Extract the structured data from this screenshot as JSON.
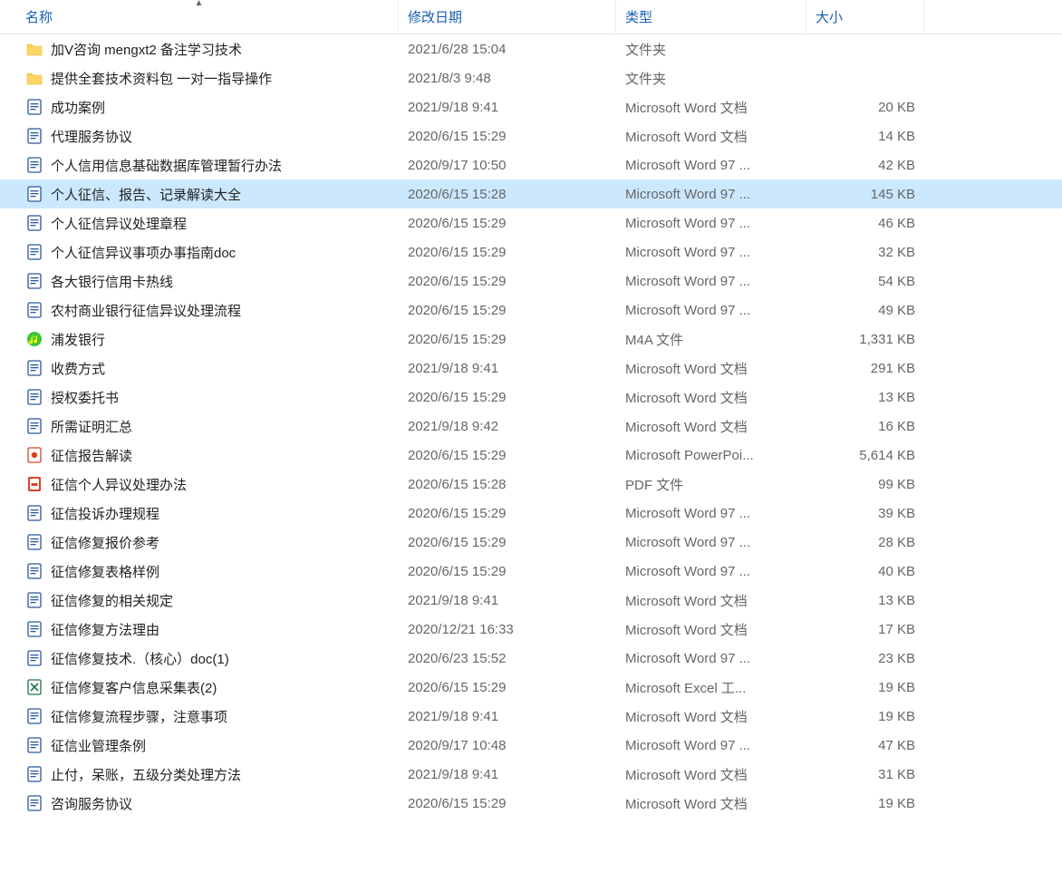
{
  "columns": {
    "name": "名称",
    "date": "修改日期",
    "type": "类型",
    "size": "大小"
  },
  "icons": {
    "folder": "folder",
    "docx": "docx",
    "doc97": "doc97",
    "xlsx": "xlsx",
    "pptx": "pptx",
    "pdf": "pdf",
    "m4a": "m4a"
  },
  "files": [
    {
      "icon": "folder",
      "name": "加V咨询   mengxt2  备注学习技术",
      "date": "2021/6/28 15:04",
      "type": "文件夹",
      "size": "",
      "selected": false
    },
    {
      "icon": "folder",
      "name": "提供全套技术资料包 一对一指导操作",
      "date": "2021/8/3 9:48",
      "type": "文件夹",
      "size": "",
      "selected": false
    },
    {
      "icon": "docx",
      "name": "成功案例",
      "date": "2021/9/18 9:41",
      "type": "Microsoft Word 文档",
      "size": "20 KB",
      "selected": false
    },
    {
      "icon": "docx",
      "name": "代理服务协议",
      "date": "2020/6/15 15:29",
      "type": "Microsoft Word 文档",
      "size": "14 KB",
      "selected": false
    },
    {
      "icon": "doc97",
      "name": "个人信用信息基础数据库管理暂行办法",
      "date": "2020/9/17 10:50",
      "type": "Microsoft Word 97 ...",
      "size": "42 KB",
      "selected": false
    },
    {
      "icon": "doc97",
      "name": "个人征信、报告、记录解读大全",
      "date": "2020/6/15 15:28",
      "type": "Microsoft Word 97 ...",
      "size": "145 KB",
      "selected": true
    },
    {
      "icon": "doc97",
      "name": "个人征信异议处理章程",
      "date": "2020/6/15 15:29",
      "type": "Microsoft Word 97 ...",
      "size": "46 KB",
      "selected": false
    },
    {
      "icon": "doc97",
      "name": "个人征信异议事项办事指南doc",
      "date": "2020/6/15 15:29",
      "type": "Microsoft Word 97 ...",
      "size": "32 KB",
      "selected": false
    },
    {
      "icon": "doc97",
      "name": "各大银行信用卡热线",
      "date": "2020/6/15 15:29",
      "type": "Microsoft Word 97 ...",
      "size": "54 KB",
      "selected": false
    },
    {
      "icon": "doc97",
      "name": "农村商业银行征信异议处理流程",
      "date": "2020/6/15 15:29",
      "type": "Microsoft Word 97 ...",
      "size": "49 KB",
      "selected": false
    },
    {
      "icon": "m4a",
      "name": "浦发银行",
      "date": "2020/6/15 15:29",
      "type": "M4A 文件",
      "size": "1,331 KB",
      "selected": false
    },
    {
      "icon": "docx",
      "name": "收费方式",
      "date": "2021/9/18 9:41",
      "type": "Microsoft Word 文档",
      "size": "291 KB",
      "selected": false
    },
    {
      "icon": "docx",
      "name": "授权委托书",
      "date": "2020/6/15 15:29",
      "type": "Microsoft Word 文档",
      "size": "13 KB",
      "selected": false
    },
    {
      "icon": "docx",
      "name": "所需证明汇总",
      "date": "2021/9/18 9:42",
      "type": "Microsoft Word 文档",
      "size": "16 KB",
      "selected": false
    },
    {
      "icon": "pptx",
      "name": "征信报告解读",
      "date": "2020/6/15 15:29",
      "type": "Microsoft PowerPoi...",
      "size": "5,614 KB",
      "selected": false
    },
    {
      "icon": "pdf",
      "name": "征信个人异议处理办法",
      "date": "2020/6/15 15:28",
      "type": "PDF 文件",
      "size": "99 KB",
      "selected": false
    },
    {
      "icon": "doc97",
      "name": "征信投诉办理规程",
      "date": "2020/6/15 15:29",
      "type": "Microsoft Word 97 ...",
      "size": "39 KB",
      "selected": false
    },
    {
      "icon": "doc97",
      "name": "征信修复报价参考",
      "date": "2020/6/15 15:29",
      "type": "Microsoft Word 97 ...",
      "size": "28 KB",
      "selected": false
    },
    {
      "icon": "doc97",
      "name": "征信修复表格样例",
      "date": "2020/6/15 15:29",
      "type": "Microsoft Word 97 ...",
      "size": "40 KB",
      "selected": false
    },
    {
      "icon": "docx",
      "name": "征信修复的相关规定",
      "date": "2021/9/18 9:41",
      "type": "Microsoft Word 文档",
      "size": "13 KB",
      "selected": false
    },
    {
      "icon": "docx",
      "name": "征信修复方法理由",
      "date": "2020/12/21 16:33",
      "type": "Microsoft Word 文档",
      "size": "17 KB",
      "selected": false
    },
    {
      "icon": "doc97",
      "name": "征信修复技术.（核心）doc(1)",
      "date": "2020/6/23 15:52",
      "type": "Microsoft Word 97 ...",
      "size": "23 KB",
      "selected": false
    },
    {
      "icon": "xlsx",
      "name": "征信修复客户信息采集表(2)",
      "date": "2020/6/15 15:29",
      "type": "Microsoft Excel 工...",
      "size": "19 KB",
      "selected": false
    },
    {
      "icon": "docx",
      "name": "征信修复流程步骤，注意事项",
      "date": "2021/9/18 9:41",
      "type": "Microsoft Word 文档",
      "size": "19 KB",
      "selected": false
    },
    {
      "icon": "doc97",
      "name": "征信业管理条例",
      "date": "2020/9/17 10:48",
      "type": "Microsoft Word 97 ...",
      "size": "47 KB",
      "selected": false
    },
    {
      "icon": "docx",
      "name": "止付，呆账，五级分类处理方法",
      "date": "2021/9/18 9:41",
      "type": "Microsoft Word 文档",
      "size": "31 KB",
      "selected": false
    },
    {
      "icon": "docx",
      "name": "咨询服务协议",
      "date": "2020/6/15 15:29",
      "type": "Microsoft Word 文档",
      "size": "19 KB",
      "selected": false
    }
  ]
}
